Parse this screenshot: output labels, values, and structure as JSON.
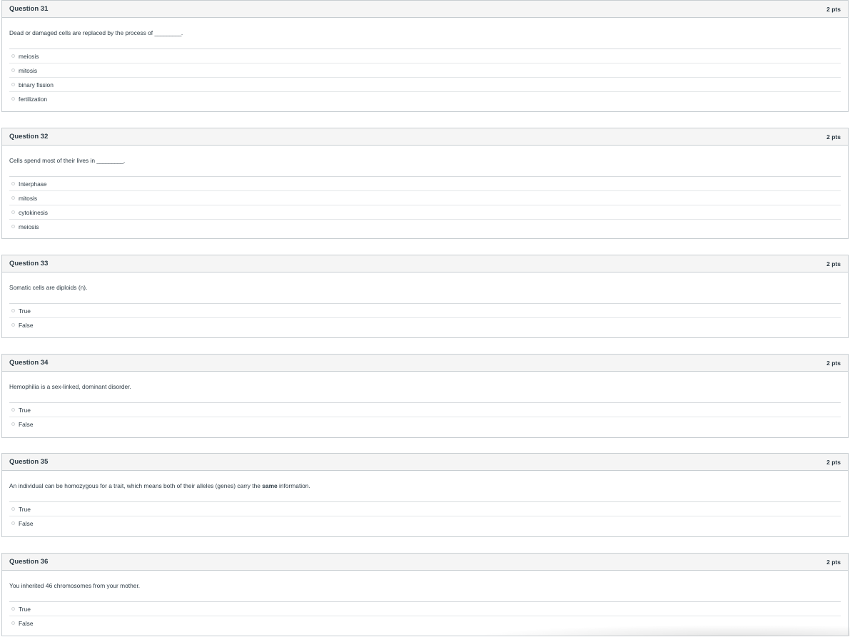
{
  "questions": [
    {
      "name": "Question 31",
      "points": "2 pts",
      "text_before": "Dead or damaged cells are replaced by the process of ",
      "text_bold": "",
      "text_after": "_________.",
      "answers": [
        "meiosis",
        "mitosis",
        "binary fission",
        "fertilization"
      ]
    },
    {
      "name": "Question 32",
      "points": "2 pts",
      "text_before": "Cells spend most of their lives in ",
      "text_bold": "",
      "text_after": "_________.",
      "answers": [
        "Interphase",
        "mitosis",
        "cytokinesis",
        "meiosis"
      ]
    },
    {
      "name": "Question 33",
      "points": "2 pts",
      "text_before": "Somatic cells are diploids (n).",
      "text_bold": "",
      "text_after": "",
      "answers": [
        "True",
        "False"
      ]
    },
    {
      "name": "Question 34",
      "points": "2 pts",
      "text_before": "Hemophilia is a sex-linked, dominant disorder.",
      "text_bold": "",
      "text_after": "",
      "answers": [
        "True",
        "False"
      ]
    },
    {
      "name": "Question 35",
      "points": "2 pts",
      "text_before": "An individual can be homozygous for a trait, which means both of their alleles (genes) carry the ",
      "text_bold": "same",
      "text_after": " information.",
      "answers": [
        "True",
        "False"
      ]
    },
    {
      "name": "Question 36",
      "points": "2 pts",
      "text_before": "You inherited 46 chromosomes from your mother.",
      "text_bold": "",
      "text_after": "",
      "answers": [
        "True",
        "False"
      ]
    }
  ]
}
